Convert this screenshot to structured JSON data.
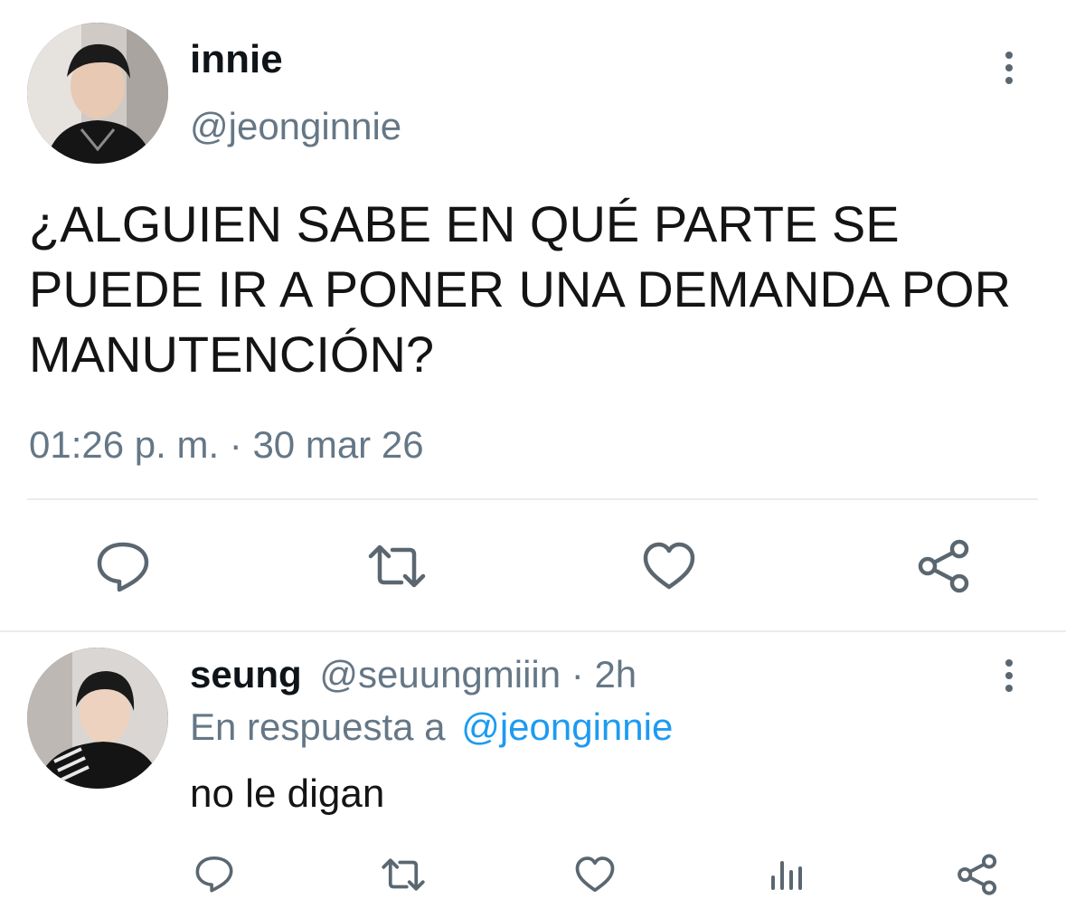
{
  "main_tweet": {
    "display_name": "innie",
    "handle": "@jeonginnie",
    "text_lines": [
      "¿ALGUIEN SABE EN QUÉ PARTE SE",
      "PUEDE IR A PONER UNA DEMANDA POR",
      "MANUTENCIÓN?"
    ],
    "timestamp": "01:26 p. m. · 30 mar 26",
    "actions": [
      "reply-icon",
      "retweet-icon",
      "like-icon",
      "share-icon"
    ]
  },
  "reply": {
    "display_name": "seung",
    "handle": "@seuungmiiin · 2h",
    "reply_prefix": "En respuesta a",
    "reply_to": "@jeonginnie",
    "text": "no le digan",
    "actions": [
      "reply-icon",
      "retweet-icon",
      "like-icon",
      "analytics-icon",
      "share-icon"
    ]
  },
  "colors": {
    "text": "#0f1419",
    "muted": "#657786",
    "link": "#1d9bf0",
    "divider": "#e9ecef"
  }
}
